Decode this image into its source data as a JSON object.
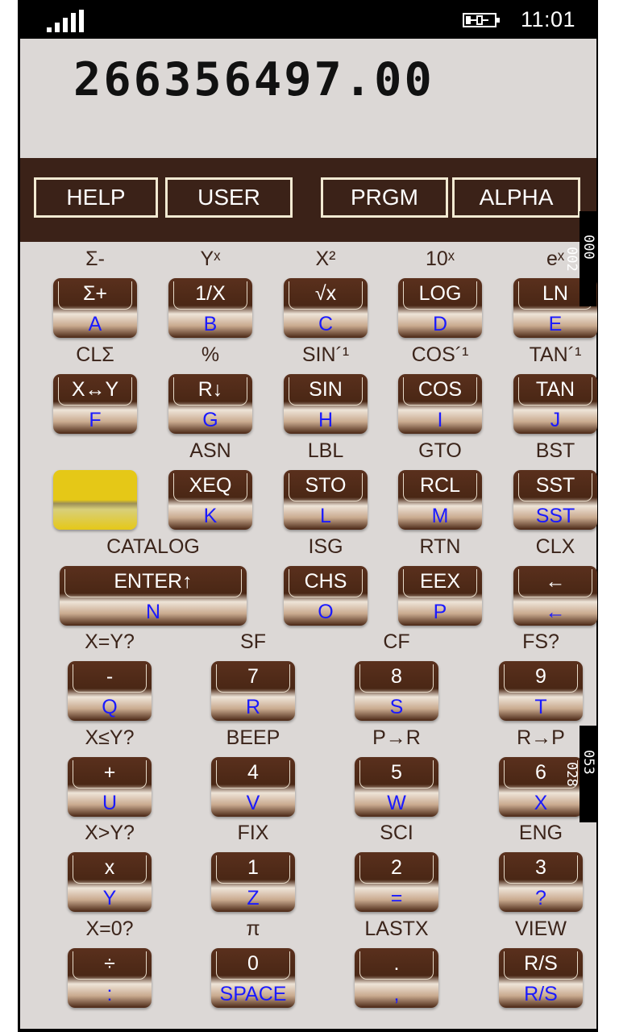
{
  "status": {
    "time": "11:01"
  },
  "display": {
    "value": "266356497.00"
  },
  "modes": [
    "HELP",
    "USER",
    "PRGM",
    "ALPHA"
  ],
  "side_tags": {
    "top_a": "000",
    "top_b": "002",
    "mid_a": "053",
    "mid_b": "028"
  },
  "rows5": [
    [
      {
        "shift": "Σ-",
        "label": "Σ+",
        "alpha": "A"
      },
      {
        "shift": "Yˣ",
        "label": "1/X",
        "alpha": "B"
      },
      {
        "shift": "X²",
        "label": "√x",
        "alpha": "C"
      },
      {
        "shift": "10ˣ",
        "label": "LOG",
        "alpha": "D"
      },
      {
        "shift": "eˣ",
        "label": "LN",
        "alpha": "E"
      }
    ],
    [
      {
        "shift": "CLΣ",
        "label": "X↔Y",
        "alpha": "F"
      },
      {
        "shift": "%",
        "label": "R↓",
        "alpha": "G"
      },
      {
        "shift": "SIN´¹",
        "label": "SIN",
        "alpha": "H"
      },
      {
        "shift": "COS´¹",
        "label": "COS",
        "alpha": "I"
      },
      {
        "shift": "TAN´¹",
        "label": "TAN",
        "alpha": "J"
      }
    ],
    [
      {
        "shift": "",
        "label": "",
        "alpha": "",
        "yellow": true
      },
      {
        "shift": "ASN",
        "label": "XEQ",
        "alpha": "K"
      },
      {
        "shift": "LBL",
        "label": "STO",
        "alpha": "L"
      },
      {
        "shift": "GTO",
        "label": "RCL",
        "alpha": "M"
      },
      {
        "shift": "BST",
        "label": "SST",
        "alpha": "SST"
      }
    ],
    [
      {
        "shift": "CATALOG",
        "label": "ENTER↑",
        "alpha": "N",
        "wide": true
      },
      {
        "shift": "ISG",
        "label": "CHS",
        "alpha": "O"
      },
      {
        "shift": "RTN",
        "label": "EEX",
        "alpha": "P"
      },
      {
        "shift": "CLX",
        "label": "←",
        "alpha": "←"
      }
    ]
  ],
  "rows4": [
    [
      {
        "shift": "X=Y?",
        "label": "-",
        "alpha": "Q"
      },
      {
        "shift": "SF",
        "label": "7",
        "alpha": "R"
      },
      {
        "shift": "CF",
        "label": "8",
        "alpha": "S"
      },
      {
        "shift": "FS?",
        "label": "9",
        "alpha": "T"
      }
    ],
    [
      {
        "shift": "X≤Y?",
        "label": "+",
        "alpha": "U"
      },
      {
        "shift": "BEEP",
        "label": "4",
        "alpha": "V"
      },
      {
        "shift": "P→R",
        "label": "5",
        "alpha": "W"
      },
      {
        "shift": "R→P",
        "label": "6",
        "alpha": "X"
      }
    ],
    [
      {
        "shift": "X>Y?",
        "label": "x",
        "alpha": "Y"
      },
      {
        "shift": "FIX",
        "label": "1",
        "alpha": "Z"
      },
      {
        "shift": "SCI",
        "label": "2",
        "alpha": "="
      },
      {
        "shift": "ENG",
        "label": "3",
        "alpha": "?"
      }
    ],
    [
      {
        "shift": "X=0?",
        "label": "÷",
        "alpha": ":"
      },
      {
        "shift": "π",
        "label": "0",
        "alpha": "SPACE"
      },
      {
        "shift": "LASTX",
        "label": ".",
        "alpha": ","
      },
      {
        "shift": "VIEW",
        "label": "R/S",
        "alpha": "R/S"
      }
    ]
  ]
}
